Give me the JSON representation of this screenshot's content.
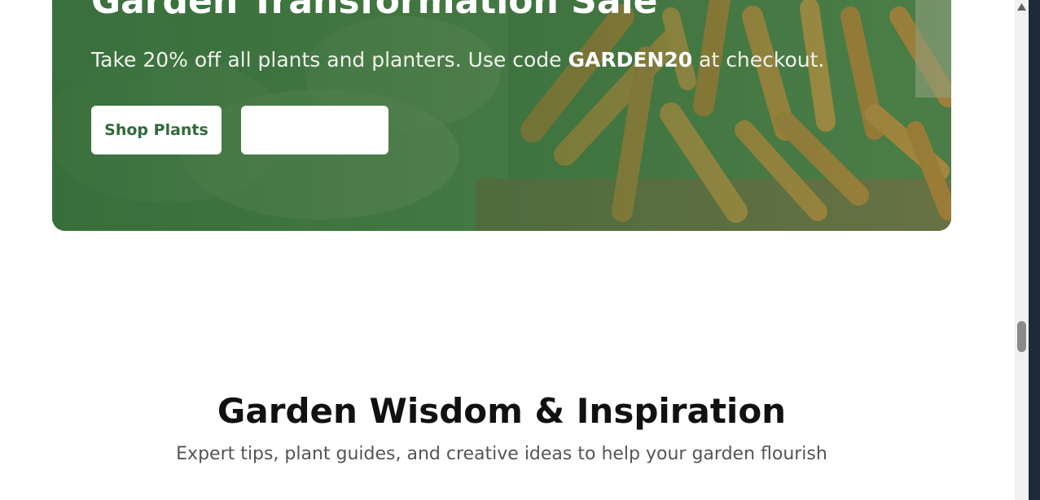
{
  "promo": {
    "title": "Garden Transformation Sale",
    "subtitle_before": "Take 20% off all plants and planters. Use code ",
    "promo_code": "GARDEN20",
    "subtitle_after": " at checkout.",
    "primary_button": "Shop Plants",
    "secondary_button": "",
    "background_image": "vegetable-market-carrots-leeks"
  },
  "wisdom": {
    "title": "Garden Wisdom & Inspiration",
    "subtitle": "Expert tips, plant guides, and creative ideas to help your garden flourish"
  },
  "scrollbar": {
    "up_icon": "triangle-up-icon",
    "position_fraction": 0.66
  },
  "colors": {
    "brand_green": "#2f6b3a",
    "overlay_green": "#286232",
    "text_dark": "#111111",
    "text_muted": "#555555"
  }
}
